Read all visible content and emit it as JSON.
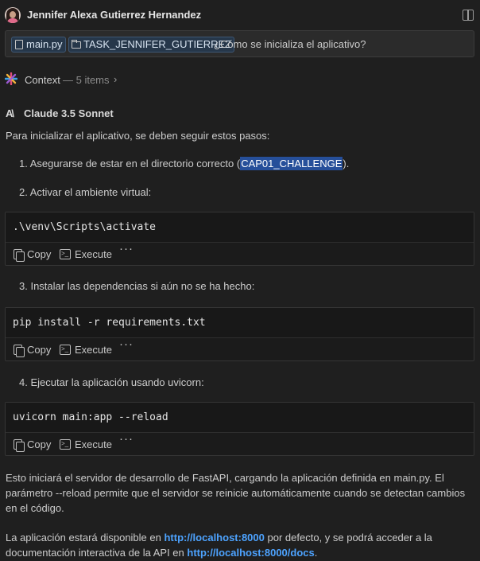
{
  "header": {
    "user_name": "Jennifer Alexa Gutierrez Hernandez",
    "avatar_icon": "user-avatar",
    "layout_icon": "split-panel-icon"
  },
  "prompt": {
    "file_chip": "main.py",
    "folder_chip": "TASK_JENNIFER_GUTIERREZ",
    "question": "¿Cómo se inicializa el aplicativo?"
  },
  "context": {
    "label": "Context",
    "count": "— 5 items",
    "chevron": "›"
  },
  "model": {
    "icon_text": "A\\",
    "name": "Claude 3.5 Sonnet"
  },
  "response": {
    "intro": "Para inicializar el aplicativo, se deben seguir estos pasos:",
    "step1_prefix": "1. Asegurarse de estar en el directorio correcto (",
    "step1_highlight": "CAP01_CHALLENGE",
    "step1_suffix": ").",
    "step2": "2. Activar el ambiente virtual:",
    "code1": ".\\venv\\Scripts\\activate",
    "step3": "3. Instalar las dependencias si aún no se ha hecho:",
    "code2": "pip install -r requirements.txt",
    "step4": "4. Ejecutar la aplicación usando uvicorn:",
    "code3": "uvicorn main:app --reload",
    "summary_line1": "Esto iniciará el servidor de desarrollo de FastAPI, cargando la aplicación definida en main.py. El",
    "summary_line2": "parámetro --reload permite que el servidor se reinicie automáticamente cuando se detectan cambios",
    "summary_line3": "en el código.",
    "final_line1_a": "La aplicación estará disponible en ",
    "final_link1": "http://localhost:8000",
    "final_line1_b": " por defecto, y se podrá acceder a la",
    "final_line2_a": "documentación interactiva de la API en ",
    "final_link2": "http://localhost:8000/docs",
    "final_line2_b": "."
  },
  "code_actions": {
    "copy": "Copy",
    "execute": "Execute",
    "more": "···"
  },
  "colors": {
    "background": "#1f1f1f",
    "link": "#4da3ff",
    "highlight": "#264f9a",
    "chip": "#26374a"
  }
}
